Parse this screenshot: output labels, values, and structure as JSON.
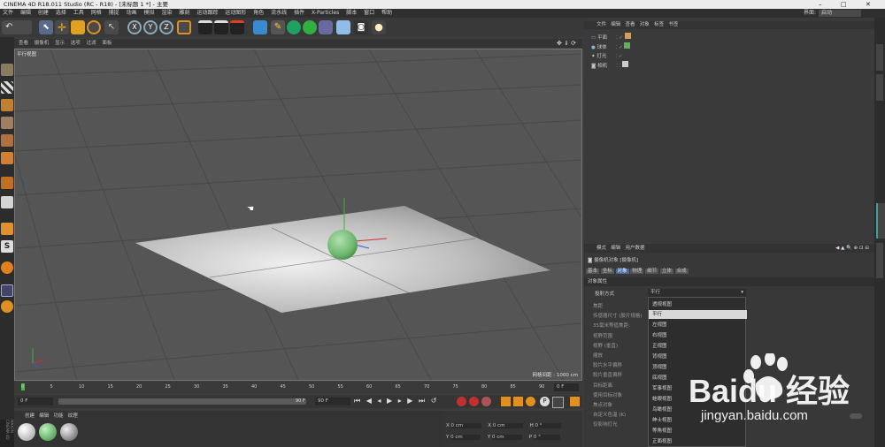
{
  "app": {
    "title": "CINEMA 4D R18.011 Studio (RC - R18) - [未标题 1 *] - 主要"
  },
  "menubar": [
    "文件",
    "编辑",
    "创建",
    "选择",
    "工具",
    "网格",
    "捕捉",
    "动画",
    "模拟",
    "渲染",
    "雕刻",
    "运动跟踪",
    "运动图形",
    "角色",
    "流水线",
    "插件",
    "X-Particles",
    "脚本",
    "窗口",
    "帮助"
  ],
  "layout": {
    "label": "界面:",
    "value": "启动"
  },
  "viewport": {
    "menu": [
      "查看",
      "摄像机",
      "显示",
      "选项",
      "过滤",
      "面板"
    ],
    "label": "平行视图",
    "grid_info": "网格间距 : 1000 cm"
  },
  "timeline": {
    "ticks": [
      "0",
      "5",
      "10",
      "15",
      "20",
      "25",
      "30",
      "35",
      "40",
      "45",
      "50",
      "55",
      "60",
      "65",
      "70",
      "75",
      "80",
      "85",
      "90"
    ],
    "end_frame": "0 F"
  },
  "transport": {
    "start": "0 F",
    "end_a": "90 F",
    "end_b": "90 F"
  },
  "material_manager": {
    "menu": [
      "创建",
      "编辑",
      "功能",
      "纹理"
    ],
    "brand": "MAXON CINEMA 4D"
  },
  "coordinates": {
    "rows": [
      {
        "a": "X",
        "av": "0 cm",
        "b": "X",
        "bv": "0 cm",
        "c": "H",
        "cv": "0 °"
      },
      {
        "a": "Y",
        "av": "0 cm",
        "b": "Y",
        "bv": "0 cm",
        "c": "P",
        "cv": "0 °"
      }
    ]
  },
  "object_manager": {
    "menu": [
      "文件",
      "编辑",
      "查看",
      "对象",
      "标签",
      "书签"
    ],
    "objects": [
      "平面",
      "球体",
      "灯光",
      "相机"
    ]
  },
  "attribute_manager": {
    "menu": [
      "模式",
      "编辑",
      "用户数据"
    ],
    "object_title": "摄像机对象 [摄像机]",
    "tabs": [
      "基本",
      "坐标",
      "对象",
      "物理",
      "细节",
      "立体",
      "合成"
    ],
    "section": "对象属性",
    "projection_label": "投射方式",
    "projection_value": "平行",
    "props": [
      "焦距",
      "传感器尺寸 (胶片规格)",
      "35毫米等值焦距:",
      "视野范围",
      "视野 (垂直)",
      "缩放",
      "胶片水平偏移",
      "胶片垂直偏移",
      "目标距离",
      "使用目标对象",
      "焦点对象",
      "自定义色温 (K)",
      "仅影响灯光"
    ],
    "dropdown": [
      "透视视图",
      "平行",
      "左视图",
      "右视图",
      "正视图",
      "背视图",
      "顶视图",
      "底视图",
      "军事视图",
      "蛙眼视图",
      "鸟瞰视图",
      "绅士视图",
      "等角视图",
      "正面视图"
    ]
  },
  "watermark": {
    "brand": "Baidu 经验",
    "url": "jingyan.baidu.com"
  }
}
